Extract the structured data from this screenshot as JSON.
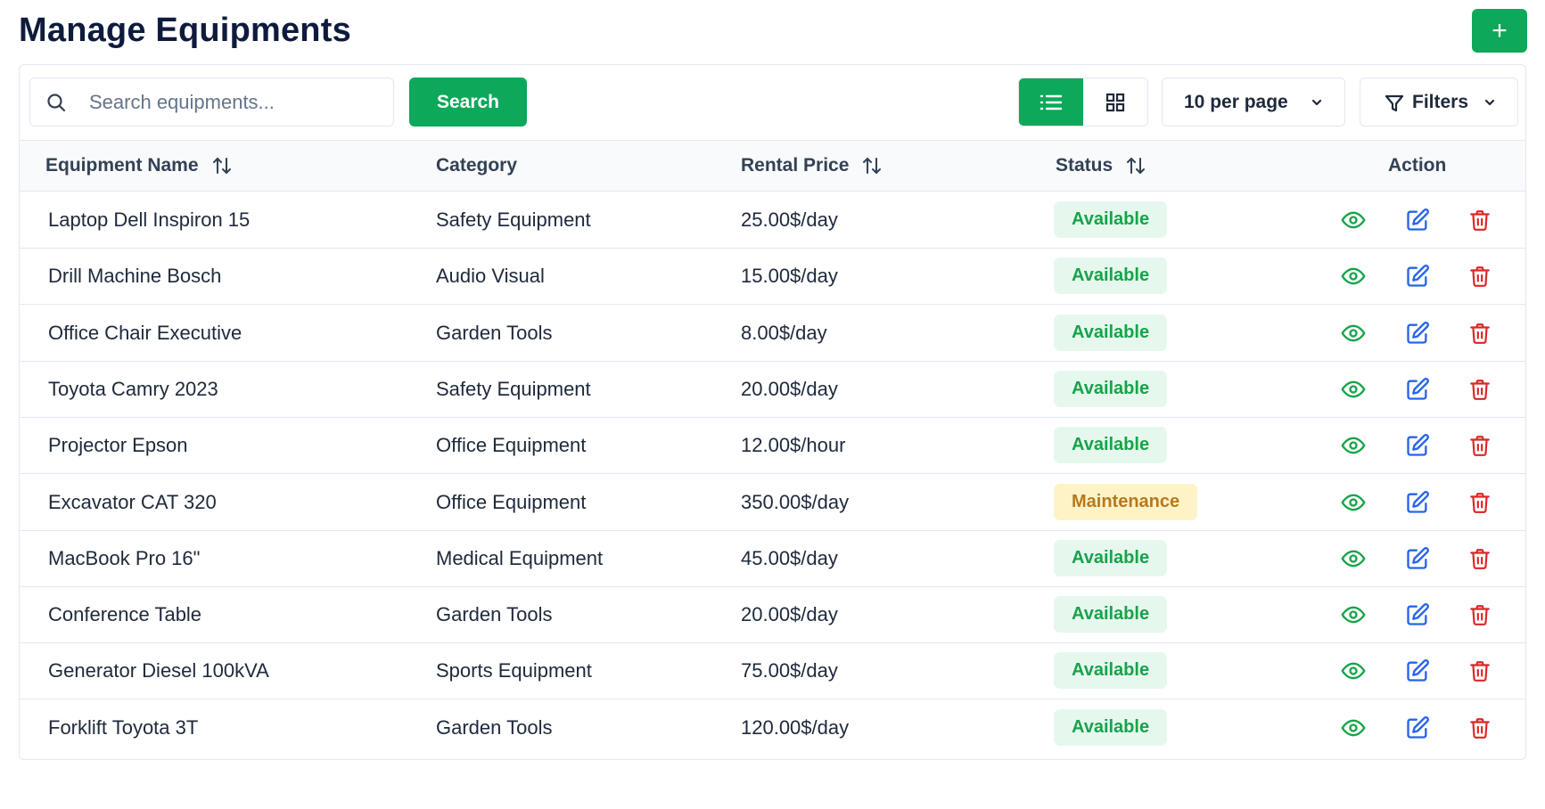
{
  "header": {
    "title": "Manage Equipments",
    "add_label": "+"
  },
  "toolbar": {
    "search_placeholder": "Search equipments...",
    "search_button": "Search",
    "per_page": "10 per page",
    "filters_label": "Filters"
  },
  "table": {
    "columns": [
      "Equipment Name",
      "Category",
      "Rental Price",
      "Status",
      "Action"
    ],
    "rows": [
      {
        "name": "Laptop Dell Inspiron 15",
        "category": "Safety Equipment",
        "price": "25.00$/day",
        "status": "Available"
      },
      {
        "name": "Drill Machine Bosch",
        "category": "Audio Visual",
        "price": "15.00$/day",
        "status": "Available"
      },
      {
        "name": "Office Chair Executive",
        "category": "Garden Tools",
        "price": "8.00$/day",
        "status": "Available"
      },
      {
        "name": "Toyota Camry 2023",
        "category": "Safety Equipment",
        "price": "20.00$/day",
        "status": "Available"
      },
      {
        "name": "Projector Epson",
        "category": "Office Equipment",
        "price": "12.00$/hour",
        "status": "Available"
      },
      {
        "name": "Excavator CAT 320",
        "category": "Office Equipment",
        "price": "350.00$/day",
        "status": "Maintenance"
      },
      {
        "name": "MacBook Pro 16\"",
        "category": "Medical Equipment",
        "price": "45.00$/day",
        "status": "Available"
      },
      {
        "name": "Conference Table",
        "category": "Garden Tools",
        "price": "20.00$/day",
        "status": "Available"
      },
      {
        "name": "Generator Diesel 100kVA",
        "category": "Sports Equipment",
        "price": "75.00$/day",
        "status": "Available"
      },
      {
        "name": "Forklift Toyota 3T",
        "category": "Garden Tools",
        "price": "120.00$/day",
        "status": "Available"
      }
    ]
  },
  "icons": {
    "search": "search-icon",
    "list_view": "list-icon",
    "grid_view": "grid-icon",
    "filter": "filter-icon",
    "chevron": "chevron-down-icon",
    "sort": "sort-icon",
    "view": "eye-icon",
    "edit": "edit-icon",
    "delete": "trash-icon"
  },
  "colors": {
    "primary": "#0ea85a",
    "available_bg": "#e6f8ee",
    "available_text": "#16a34a",
    "maintenance_bg": "#fef3c7",
    "maintenance_text": "#b7791f",
    "view_icon": "#16a34a",
    "edit_icon": "#2563eb",
    "delete_icon": "#dc2626"
  }
}
